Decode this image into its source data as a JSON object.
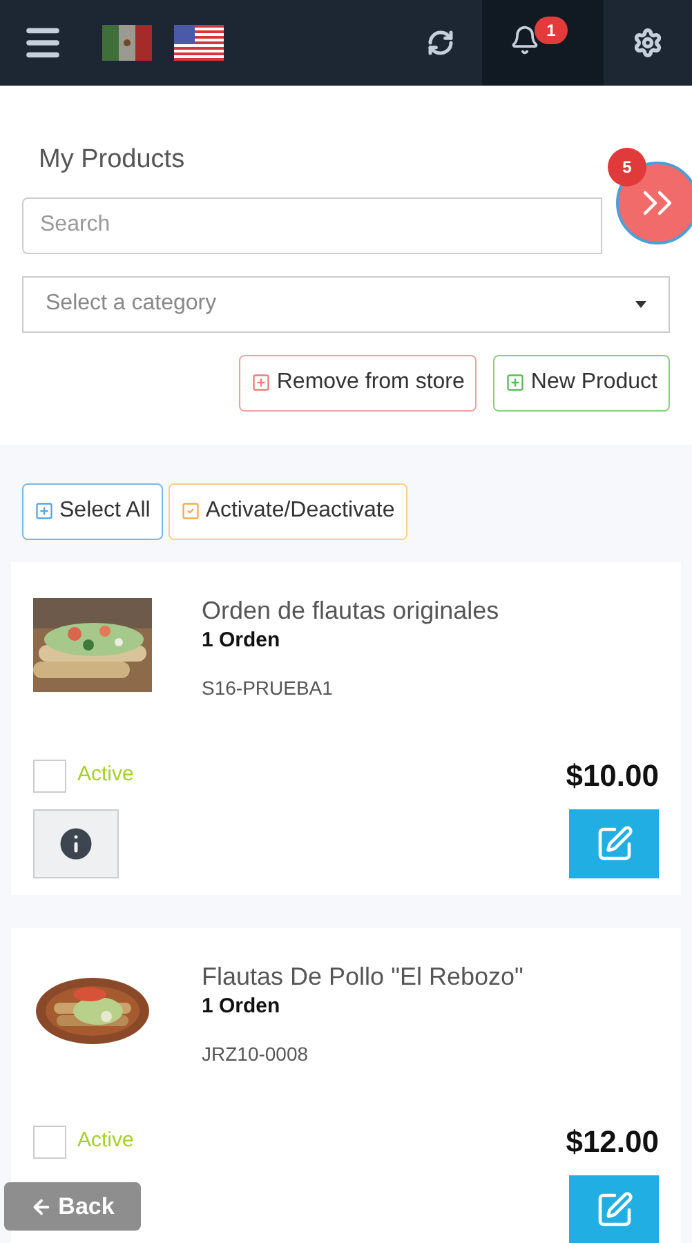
{
  "header": {
    "notification_count": "1"
  },
  "page": {
    "title": "My Products",
    "floating_badge": "5"
  },
  "search": {
    "placeholder": "Search"
  },
  "category": {
    "placeholder": "Select a category"
  },
  "actions": [
    {
      "kind": "remove",
      "label": "Remove from store"
    },
    {
      "kind": "add",
      "label": "New Product"
    }
  ],
  "bulk_actions": [
    {
      "kind": "select",
      "label": "Select All"
    },
    {
      "kind": "toggle",
      "label": "Activate/Deactivate"
    }
  ],
  "products": [
    {
      "name": "Orden de flautas originales",
      "unit": "1 Orden",
      "sku": "S16-PRUEBA1",
      "status": "Active",
      "checked": false,
      "price": "$10.00"
    },
    {
      "name": "Flautas De Pollo \"El Rebozo\"",
      "unit": "1 Orden",
      "sku": "JRZ10-0008",
      "status": "Active",
      "checked": false,
      "price": "$12.00"
    }
  ],
  "back_button": "Back"
}
